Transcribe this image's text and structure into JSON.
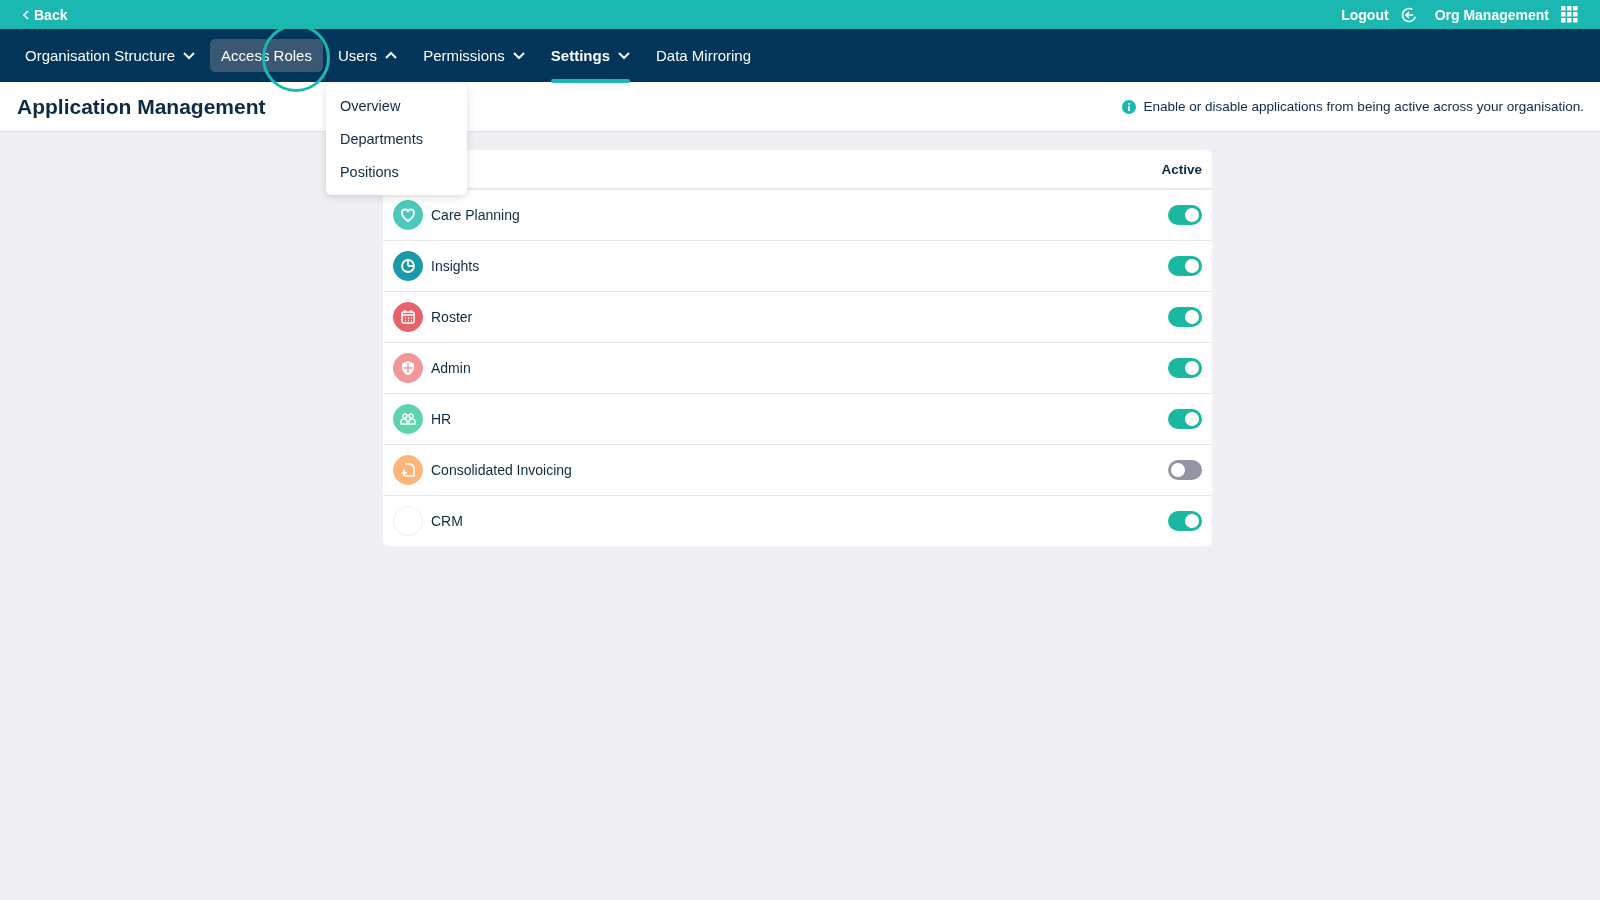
{
  "top_bar": {
    "back": "Back",
    "logout": "Logout",
    "org_management": "Org Management"
  },
  "nav": [
    {
      "label": "Organisation Structure",
      "kind": "dropdown",
      "selected": false,
      "highlighted": false,
      "expanded": false
    },
    {
      "label": "Access Roles",
      "kind": "link",
      "selected": false,
      "highlighted": true
    },
    {
      "label": "Users",
      "kind": "dropdown",
      "selected": false,
      "highlighted": false,
      "expanded": true
    },
    {
      "label": "Permissions",
      "kind": "dropdown",
      "selected": false,
      "highlighted": false,
      "expanded": false
    },
    {
      "label": "Settings",
      "kind": "dropdown",
      "selected": true,
      "highlighted": false,
      "expanded": false
    },
    {
      "label": "Data Mirroring",
      "kind": "link",
      "selected": false,
      "highlighted": false
    }
  ],
  "users_menu": [
    "Overview",
    "Departments",
    "Positions"
  ],
  "page": {
    "title": "Application Management",
    "info": "Enable or disable applications from being active across your organisation."
  },
  "table": {
    "columns": [
      "Active"
    ],
    "rows": [
      {
        "name": "Care Planning",
        "color": "#4cc9bd",
        "active": true
      },
      {
        "name": "Insights",
        "color": "#1a9aa8",
        "active": true
      },
      {
        "name": "Roster",
        "color": "#e8626a",
        "active": true
      },
      {
        "name": "Admin",
        "color": "#f3979b",
        "active": true
      },
      {
        "name": "HR",
        "color": "#5fd3ad",
        "active": true
      },
      {
        "name": "Consolidated Invoicing",
        "color": "#fdb57a",
        "active": false
      },
      {
        "name": "CRM",
        "color": "#ffffff",
        "active": true
      }
    ]
  }
}
